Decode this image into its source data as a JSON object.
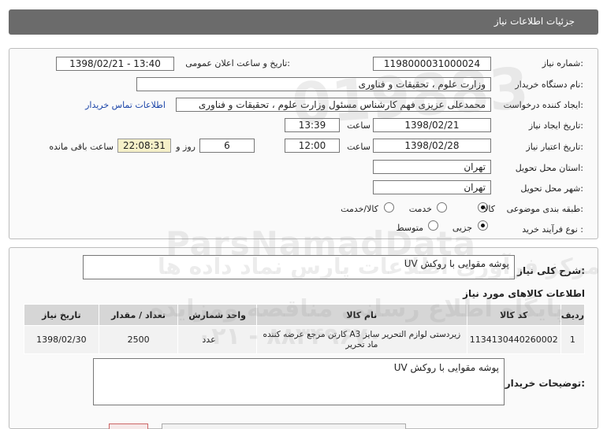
{
  "header": {
    "title": "جزئیات اطلاعات نیاز"
  },
  "form": {
    "need_number_label": "شماره نیاز:",
    "need_number": "1198000031000024",
    "announce_label": "تاریخ و ساعت اعلان عمومی:",
    "announce_value": "1398/02/21 - 13:40",
    "buyer_label": "نام دستگاه خریدار:",
    "buyer_value": "وزارت علوم ، تحقیقات و فناوری",
    "creator_label": "ایجاد کننده درخواست:",
    "creator_value": "محمدعلی عزیزی فهم کارشناس مسئول وزارت علوم ، تحقیقات و فناوری",
    "contact_link": "اطلاعات تماس خریدار",
    "create_date_label": "تاریخ ایجاد نیاز:",
    "create_date": "1398/02/21",
    "time_label": "ساعت",
    "create_time": "13:39",
    "valid_date_label": "تاریخ اعتبار نیاز:",
    "valid_date": "1398/02/28",
    "valid_time": "12:00",
    "days_value": "6",
    "days_label": "روز و",
    "remaining_value": "22:08:31",
    "remaining_label": "ساعت باقی مانده",
    "province_label": "استان محل تحویل:",
    "province_value": "تهران",
    "city_label": "شهر محل تحویل:",
    "city_value": "تهران",
    "category_label": "طبقه بندی موضوعی:",
    "category_options": [
      "کالا",
      "خدمت",
      "کالا/خدمت"
    ],
    "category_selected": "کالا",
    "process_label": "نوع فرآیند خرید :",
    "process_options": [
      "جزیی",
      "متوسط"
    ],
    "process_selected": "جزیی"
  },
  "summary": {
    "label": "شرح کلی نیاز:",
    "value": "پوشه مقوایی با روکش UV"
  },
  "items_section": {
    "title": "اطلاعات کالاهای مورد نیاز",
    "columns": [
      "ردیف",
      "کد کالا",
      "نام کالا",
      "واحد شمارش",
      "تعداد / مقدار",
      "تاریخ نیاز"
    ],
    "rows": [
      [
        "1",
        "1134130440260002",
        "زیردستی لوازم التحریر سایز A3 کارتن مرجع عرضه کننده ماد تحریر",
        "عدد",
        "2500",
        "1398/02/30"
      ]
    ]
  },
  "notes": {
    "label": "توضیحات خریدار:",
    "value": "پوشه مقوایی با روکش UV"
  },
  "watermark": {
    "brand": "ParsNamadData",
    "line1": "مرکز فرآوری اطلاعات پارس نماد داده ها",
    "line2": "پایگاه اطلاع رسانی مناقصه ومزایده",
    "phone": "۰۲۱ - ۸۸۳۴۹۶۷۰",
    "digits": "019883"
  }
}
